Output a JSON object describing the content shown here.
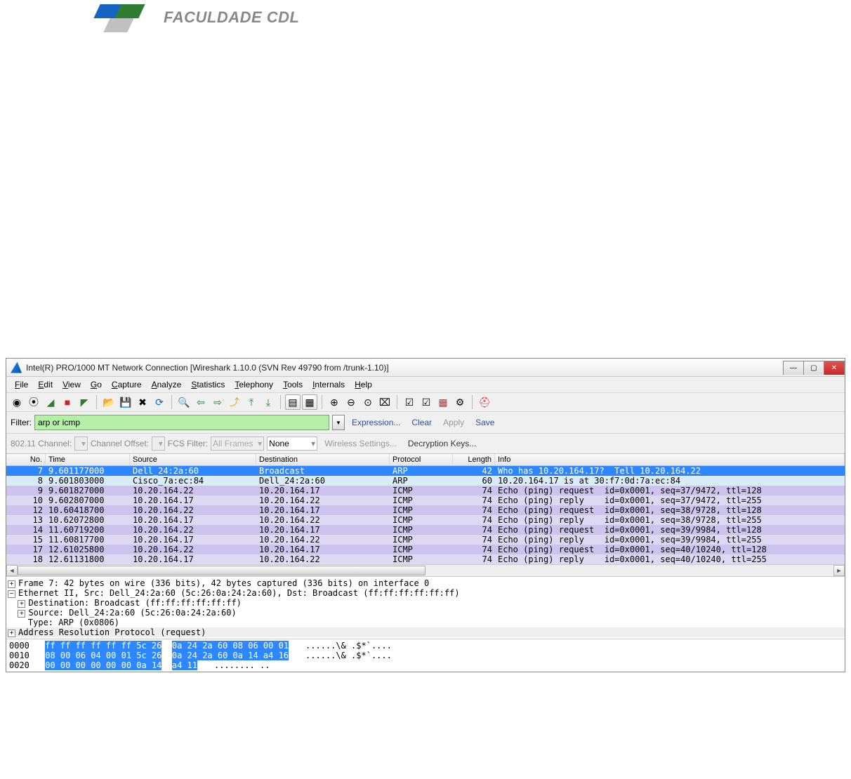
{
  "logo": {
    "text": "FACULDADE CDL"
  },
  "window": {
    "title": "Intel(R) PRO/1000 MT Network Connection   [Wireshark 1.10.0  (SVN Rev 49790 from /trunk-1.10)]"
  },
  "menubar": [
    "File",
    "Edit",
    "View",
    "Go",
    "Capture",
    "Analyze",
    "Statistics",
    "Telephony",
    "Tools",
    "Internals",
    "Help"
  ],
  "filter": {
    "label": "Filter:",
    "value": "arp or icmp",
    "btn_expression": "Expression...",
    "btn_clear": "Clear",
    "btn_apply": "Apply",
    "btn_save": "Save"
  },
  "wireless": {
    "channel_lbl": "802.11 Channel:",
    "offset_lbl": "Channel Offset:",
    "fcs_lbl": "FCS Filter:",
    "fcs_val": "All Frames",
    "none": "None",
    "settings": "Wireless Settings...",
    "keys": "Decryption Keys..."
  },
  "columns": {
    "no": "No.",
    "time": "Time",
    "src": "Source",
    "dst": "Destination",
    "prot": "Protocol",
    "len": "Length",
    "info": "Info"
  },
  "packets": [
    {
      "no": "7",
      "time": "9.601177000",
      "src": "Dell_24:2a:60",
      "dst": "Broadcast",
      "prot": "ARP",
      "len": "42",
      "info": "Who has 10.20.164.17?  Tell 10.20.164.22",
      "cls": "sel"
    },
    {
      "no": "8",
      "time": "9.601803000",
      "src": "Cisco_7a:ec:84",
      "dst": "Dell_24:2a:60",
      "prot": "ARP",
      "len": "60",
      "info": "10.20.164.17 is at 30:f7:0d:7a:ec:84",
      "cls": "arp2"
    },
    {
      "no": "9",
      "time": "9.601827000",
      "src": "10.20.164.22",
      "dst": "10.20.164.17",
      "prot": "ICMP",
      "len": "74",
      "info": "Echo (ping) request  id=0x0001, seq=37/9472, ttl=128",
      "cls": "icmp1"
    },
    {
      "no": "10",
      "time": "9.602807000",
      "src": "10.20.164.17",
      "dst": "10.20.164.22",
      "prot": "ICMP",
      "len": "74",
      "info": "Echo (ping) reply    id=0x0001, seq=37/9472, ttl=255",
      "cls": "icmp2"
    },
    {
      "no": "12",
      "time": "10.60418700",
      "src": "10.20.164.22",
      "dst": "10.20.164.17",
      "prot": "ICMP",
      "len": "74",
      "info": "Echo (ping) request  id=0x0001, seq=38/9728, ttl=128",
      "cls": "icmp1"
    },
    {
      "no": "13",
      "time": "10.62072800",
      "src": "10.20.164.17",
      "dst": "10.20.164.22",
      "prot": "ICMP",
      "len": "74",
      "info": "Echo (ping) reply    id=0x0001, seq=38/9728, ttl=255",
      "cls": "icmp2"
    },
    {
      "no": "14",
      "time": "11.60719200",
      "src": "10.20.164.22",
      "dst": "10.20.164.17",
      "prot": "ICMP",
      "len": "74",
      "info": "Echo (ping) request  id=0x0001, seq=39/9984, ttl=128",
      "cls": "icmp1"
    },
    {
      "no": "15",
      "time": "11.60817700",
      "src": "10.20.164.17",
      "dst": "10.20.164.22",
      "prot": "ICMP",
      "len": "74",
      "info": "Echo (ping) reply    id=0x0001, seq=39/9984, ttl=255",
      "cls": "icmp2"
    },
    {
      "no": "17",
      "time": "12.61025800",
      "src": "10.20.164.22",
      "dst": "10.20.164.17",
      "prot": "ICMP",
      "len": "74",
      "info": "Echo (ping) request  id=0x0001, seq=40/10240, ttl=128",
      "cls": "icmp1"
    },
    {
      "no": "18",
      "time": "12.61131800",
      "src": "10.20.164.17",
      "dst": "10.20.164.22",
      "prot": "ICMP",
      "len": "74",
      "info": "Echo (ping) reply    id=0x0001, seq=40/10240, ttl=255",
      "cls": "icmp2"
    }
  ],
  "details": {
    "l0": "Frame 7: 42 bytes on wire (336 bits), 42 bytes captured (336 bits) on interface 0",
    "l1": "Ethernet II, Src: Dell_24:2a:60 (5c:26:0a:24:2a:60), Dst: Broadcast (ff:ff:ff:ff:ff:ff)",
    "l2": "Destination: Broadcast (ff:ff:ff:ff:ff:ff)",
    "l3": "Source: Dell_24:2a:60 (5c:26:0a:24:2a:60)",
    "l4": "Type: ARP (0x0806)",
    "l5": "Address Resolution Protocol (request)"
  },
  "hex": [
    {
      "off": "0000",
      "h1": "ff ff ff ff ff ff 5c 26",
      "h2": "0a 24 2a 60 08 06 00 01",
      "asc": "......\\& .$*`...."
    },
    {
      "off": "0010",
      "h1": "08 00 06 04 00 01 5c 26",
      "h2": "0a 24 2a 60 0a 14 a4 16",
      "asc": "......\\& .$*`...."
    },
    {
      "off": "0020",
      "h1": "00 00 00 00 00 00 0a 14",
      "h2": "a4 11",
      "asc": "........ .."
    }
  ]
}
